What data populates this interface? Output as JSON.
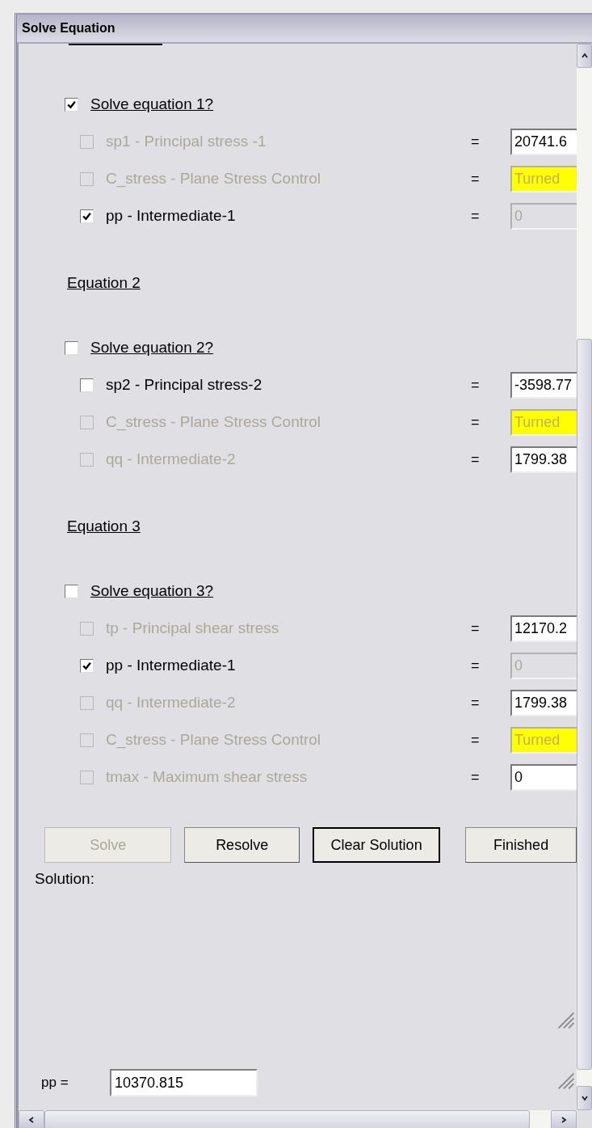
{
  "window": {
    "title": "Solve Equation"
  },
  "equations": [
    {
      "solve": {
        "label": "Solve equation 1?",
        "checked": true
      },
      "variables": [
        {
          "label": "sp1 - Principal stress -1",
          "checked": false,
          "disabled": true,
          "field": {
            "value": "20741.6",
            "disabled": false,
            "highlighted": false
          }
        },
        {
          "label": "C_stress - Plane Stress Control",
          "checked": false,
          "disabled": true,
          "field": {
            "value": "Turned",
            "disabled": true,
            "highlighted": true
          }
        },
        {
          "label": "pp - Intermediate-1",
          "checked": true,
          "disabled": false,
          "field": {
            "value": "0",
            "disabled": true,
            "highlighted": false
          }
        }
      ]
    },
    {
      "heading": "Equation 2",
      "solve": {
        "label": "Solve equation 2?",
        "checked": false
      },
      "variables": [
        {
          "label": "sp2 - Principal stress-2",
          "checked": false,
          "disabled": false,
          "field": {
            "value": "-3598.77",
            "disabled": false,
            "highlighted": false
          }
        },
        {
          "label": "C_stress - Plane Stress Control",
          "checked": false,
          "disabled": true,
          "field": {
            "value": "Turned",
            "disabled": true,
            "highlighted": true
          }
        },
        {
          "label": "qq - Intermediate-2",
          "checked": false,
          "disabled": true,
          "field": {
            "value": "1799.38",
            "disabled": false,
            "highlighted": false
          }
        }
      ]
    },
    {
      "heading": "Equation 3",
      "solve": {
        "label": "Solve equation 3?",
        "checked": false
      },
      "variables": [
        {
          "label": "tp - Principal shear stress",
          "checked": false,
          "disabled": true,
          "field": {
            "value": "12170.2",
            "disabled": false,
            "highlighted": false
          }
        },
        {
          "label": "pp - Intermediate-1",
          "checked": true,
          "disabled": false,
          "field": {
            "value": "0",
            "disabled": true,
            "highlighted": false
          }
        },
        {
          "label": "qq - Intermediate-2",
          "checked": false,
          "disabled": true,
          "field": {
            "value": "1799.38",
            "disabled": false,
            "highlighted": false
          }
        },
        {
          "label": "C_stress - Plane Stress Control",
          "checked": false,
          "disabled": true,
          "field": {
            "value": "Turned",
            "disabled": true,
            "highlighted": true
          }
        },
        {
          "label": "tmax - Maximum shear stress",
          "checked": false,
          "disabled": true,
          "field": {
            "value": "0",
            "disabled": false,
            "highlighted": false
          }
        }
      ]
    }
  ],
  "equals_sign": "=",
  "buttons": [
    {
      "label": "Solve",
      "disabled": true,
      "default": false
    },
    {
      "label": "Resolve",
      "disabled": false,
      "default": false
    },
    {
      "label": "Clear Solution",
      "disabled": false,
      "default": true
    },
    {
      "label": "Finished",
      "disabled": false,
      "default": false
    }
  ],
  "solution_label": "Solution:",
  "result": {
    "label": "pp =",
    "value": "10370.815"
  }
}
